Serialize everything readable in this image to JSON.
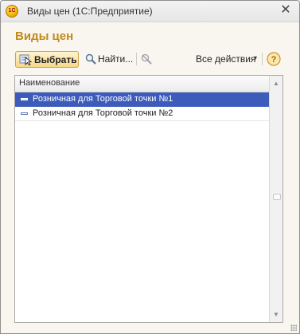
{
  "window": {
    "title": "Виды цен  (1С:Предприятие)",
    "close_symbol": "✕",
    "logo_text": "1С"
  },
  "form": {
    "title": "Виды цен"
  },
  "toolbar": {
    "select_label": "Выбрать",
    "find_label": "Найти...",
    "all_actions_label": "Все действия",
    "all_actions_caret": "▾",
    "help_symbol": "?"
  },
  "list": {
    "column_header": "Наименование",
    "rows": [
      {
        "name": "Розничная для Торговой точки №1",
        "selected": true
      },
      {
        "name": "Розничная для Торговой точки №2",
        "selected": false
      }
    ]
  },
  "scrollbar": {
    "up_symbol": "▲",
    "down_symbol": "▼"
  },
  "colors": {
    "form_title": "#c08a1a",
    "selection": "#3c5bbb",
    "select_button": "#f5d98a"
  },
  "icons": {
    "app": "1c-logo-icon",
    "select": "select-cursor-icon",
    "find": "magnifier-icon",
    "clear_search": "clear-search-icon",
    "help": "help-icon",
    "row_marker": "catalog-item-icon"
  }
}
